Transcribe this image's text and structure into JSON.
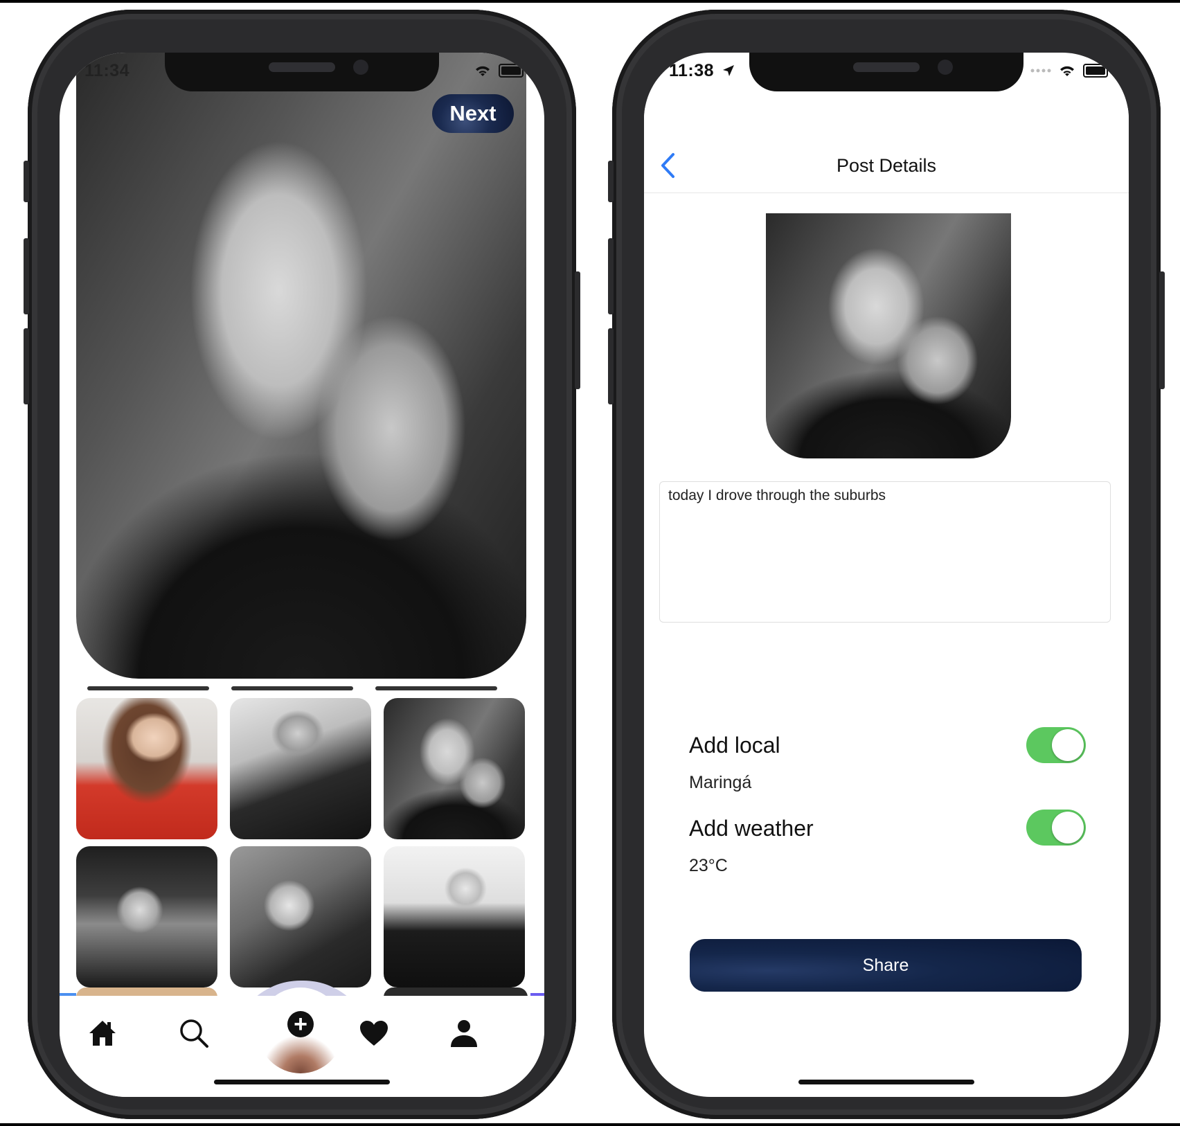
{
  "left": {
    "status": {
      "time": "11:34"
    },
    "next_label": "Next",
    "tabs": [
      {
        "name": "home-icon"
      },
      {
        "name": "search-icon"
      },
      {
        "name": "add-post-icon"
      },
      {
        "name": "heart-icon"
      },
      {
        "name": "profile-icon"
      }
    ]
  },
  "right": {
    "status": {
      "time": "11:38"
    },
    "nav_title": "Post Details",
    "caption": "today I drove through the suburbs",
    "local": {
      "label": "Add local",
      "value": "Maringá",
      "enabled": true
    },
    "weather": {
      "label": "Add weather",
      "value": "23°C",
      "enabled": true
    },
    "share_label": "Share"
  },
  "colors": {
    "accent": "#2f7bf6",
    "toggle_on": "#5cc85f",
    "button_navy": "#14264a"
  }
}
